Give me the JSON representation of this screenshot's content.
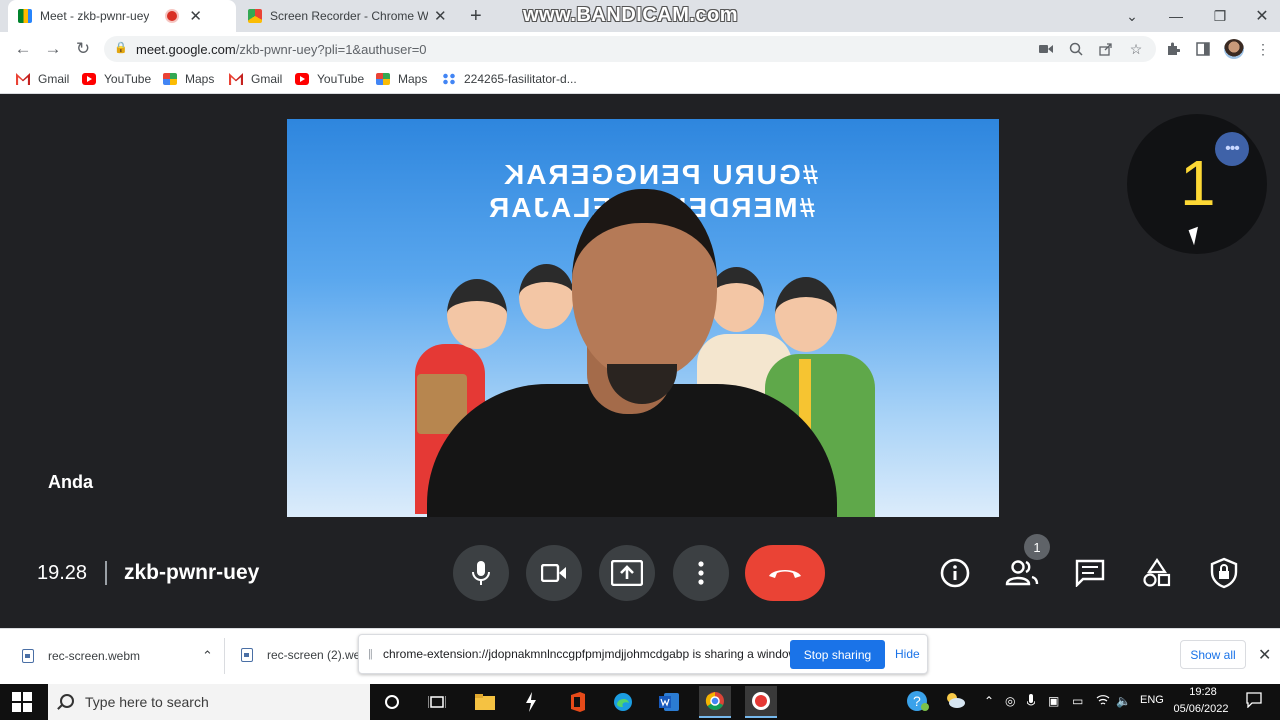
{
  "browser": {
    "tabs": [
      {
        "title": "Meet - zkb-pwnr-uey",
        "active": true,
        "recording": true
      },
      {
        "title": "Screen Recorder - Chrome Web S",
        "active": false
      }
    ],
    "new_tab_label": "+",
    "watermark": "www.BANDICAM.com",
    "address": {
      "host": "meet.google.com",
      "path": "/zkb-pwnr-uey?pli=1&authuser=0"
    },
    "bookmarks": [
      {
        "label": "Gmail",
        "icon": "gmail-icon"
      },
      {
        "label": "YouTube",
        "icon": "youtube-icon"
      },
      {
        "label": "Maps",
        "icon": "maps-icon"
      },
      {
        "label": "Gmail",
        "icon": "gmail-icon"
      },
      {
        "label": "YouTube",
        "icon": "youtube-icon"
      },
      {
        "label": "Maps",
        "icon": "maps-icon"
      },
      {
        "label": "224265-fasilitator-d...",
        "icon": "app-icon"
      }
    ]
  },
  "meet": {
    "video_banner_line1": "#GURU PENGGERAK",
    "video_banner_line2": "#MERDEKA BELAJAR",
    "self_name": "Anda",
    "other_tile_count": "1",
    "time": "19.28",
    "meeting_code": "zkb-pwnr-uey",
    "people_badge": "1",
    "colors": {
      "background": "#202124",
      "control": "#3c4043",
      "hangup": "#ea4335",
      "tile_number": "#fdd835"
    }
  },
  "downloads": {
    "items": [
      "rec-screen.webm",
      "rec-screen (2).we"
    ],
    "sharing_message": "chrome-extension://jdopnakmnlnccgpfpmjmdjjohmcdgabp is sharing a window.",
    "stop_sharing_label": "Stop sharing",
    "hide_label": "Hide",
    "show_all_label": "Show all"
  },
  "taskbar": {
    "search_placeholder": "Type here to search",
    "language": "ENG",
    "time": "19:28",
    "date": "05/06/2022"
  }
}
